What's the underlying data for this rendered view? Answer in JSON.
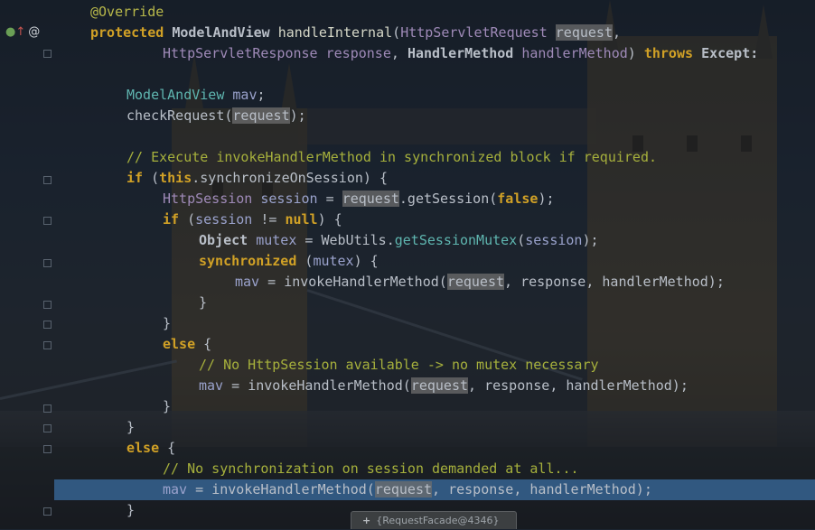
{
  "editor": {
    "gutter": {
      "markers": [
        "override-marker",
        "annotation-marker"
      ],
      "at_glyph": "@"
    },
    "lines": {
      "l1_annotation": "@Override",
      "l2_protected": "protected",
      "l2_type": "ModelAndView",
      "l2_method": "handleInternal",
      "l2_param_type": "HttpServletRequest",
      "l2_param": "request",
      "l3_type1": "HttpServletResponse",
      "l3_param1": "response",
      "l3_type2": "HandlerMethod",
      "l3_param2": "handlerMethod",
      "l3_throws": "throws",
      "l3_exception": "Except:",
      "l5_type": "ModelAndView",
      "l5_var": "mav",
      "l6_call": "checkRequest",
      "l6_arg": "request",
      "l8_comment": "// Execute invokeHandlerMethod in synchronized block if required.",
      "l9_if": "if",
      "l9_this": "this",
      "l9_field": "synchronizeOnSession",
      "l10_type": "HttpSession",
      "l10_var": "session",
      "l10_req": "request",
      "l10_call": ".getSession(",
      "l10_false": "false",
      "l11_if": "if",
      "l11_var": "session",
      "l11_null": "null",
      "l12_type": "Object",
      "l12_var": "mutex",
      "l12_util": "WebUtils",
      "l12_method": "getSessionMutex",
      "l12_arg": "session",
      "l13_sync": "synchronized",
      "l13_var": "mutex",
      "l14_var": "mav",
      "l14_call": "invokeHandlerMethod",
      "l14_req": "request",
      "l14_rest": ", response, handlerMethod);",
      "l17_else": "else",
      "l18_comment": "// No HttpSession available -> no mutex necessary",
      "l19_var": "mav",
      "l19_call": "invokeHandlerMethod",
      "l19_req": "request",
      "l19_rest": ", response, handlerMethod);",
      "l22_else": "else",
      "l23_comment": "// No synchronization on session demanded at all...",
      "l24_var": "mav",
      "l24_call": "invokeHandlerMethod",
      "l24_req": "request",
      "l24_rest": ", response, handlerMethod);"
    },
    "tooltip": {
      "plus": "+",
      "text": "{RequestFacade@4346}"
    },
    "colors": {
      "keyword": "#d1a126",
      "comment": "#a6b03c",
      "selection_line": "#396ca0"
    }
  }
}
